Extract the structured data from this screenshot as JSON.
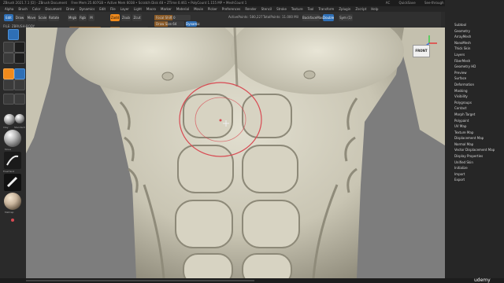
{
  "titlebar": {
    "title": "ZBrush 2021.7.1 [D] - ZBrush Document",
    "stats": "Free Mem 25.607GB • Active Mem 6038 • Scratch Disk 48 • ZTime 0.461 • PolyCount 1.155 MP • MeshCount 1",
    "right_items": [
      "AC",
      "QuickSave",
      "See-through 0",
      "Menus",
      "DefaultZScript"
    ]
  },
  "menubar": {
    "items": [
      "Alpha",
      "Brush",
      "Color",
      "Document",
      "Draw",
      "Dynamics",
      "Edit",
      "File",
      "Layer",
      "Light",
      "Macro",
      "Marker",
      "Material",
      "Movie",
      "Picker",
      "Preferences",
      "Render",
      "Stencil",
      "Stroke",
      "Texture",
      "Tool",
      "Transform",
      "Zplugin",
      "Zscript",
      "Help"
    ]
  },
  "doc_label": "FILE: ZBRUSH-BODY",
  "toolbar": {
    "edit_label": "Edit",
    "draw_label": "Draw",
    "move_label": "Move",
    "scale_label": "Scale",
    "rotate_label": "Rotate",
    "mrgb_label": "Mrgb",
    "rgb_label": "Rgb",
    "m_label": "M",
    "zadd_label": "Zadd",
    "zsub_label": "Zsub",
    "zcut_label": "Zcut",
    "focal_label": "Focal Shift 0",
    "draw_size_label": "Draw Size 64",
    "dynamic_label": "Dynamic",
    "z_intensity_label": "Z Intensity 25",
    "rgb_intensity_label": "Rgb Intensity 100",
    "active_points": "ActivePoints: 580,227",
    "total_points": "TotalPoints: 11.000 Mil",
    "backface_label": "BackfaceMask",
    "double_label": "Double",
    "sym_label": "Sym (1)"
  },
  "toolbar_levels": {
    "focal_fill": 0.5,
    "draw_size_fill": 0.45,
    "z_intensity_fill": 0.25,
    "rgb_intensity_fill": 1.0
  },
  "left_tray": {
    "labels": [
      "Clay",
      "Standard",
      "Move",
      "FreeHand",
      "MatCap"
    ]
  },
  "logo_label": "ZBrush",
  "front_label": "FRONT",
  "right_panel": {
    "items": [
      "Subtool",
      "Geometry",
      "ArrayMesh",
      "NanoMesh",
      "Thick Skin",
      "Layers",
      "FiberMesh",
      "Geometry HD",
      "Preview",
      "Surface",
      "Deformation",
      "Masking",
      "Visibility",
      "Polygroups",
      "Contact",
      "Morph Target",
      "Polypaint",
      "UV Map",
      "Texture Map",
      "Displacement Map",
      "Normal Map",
      "Vector Displacement Map",
      "Display Properties",
      "Unified Skin",
      "Initialize",
      "Import",
      "Export"
    ]
  },
  "watermark": "udemy",
  "colors": {
    "accent": "#f08a1c",
    "blue": "#2e6fb6",
    "canvas": "#7d7d7d",
    "model": "#d8d6c8",
    "brush_ring": "#d84a52"
  }
}
